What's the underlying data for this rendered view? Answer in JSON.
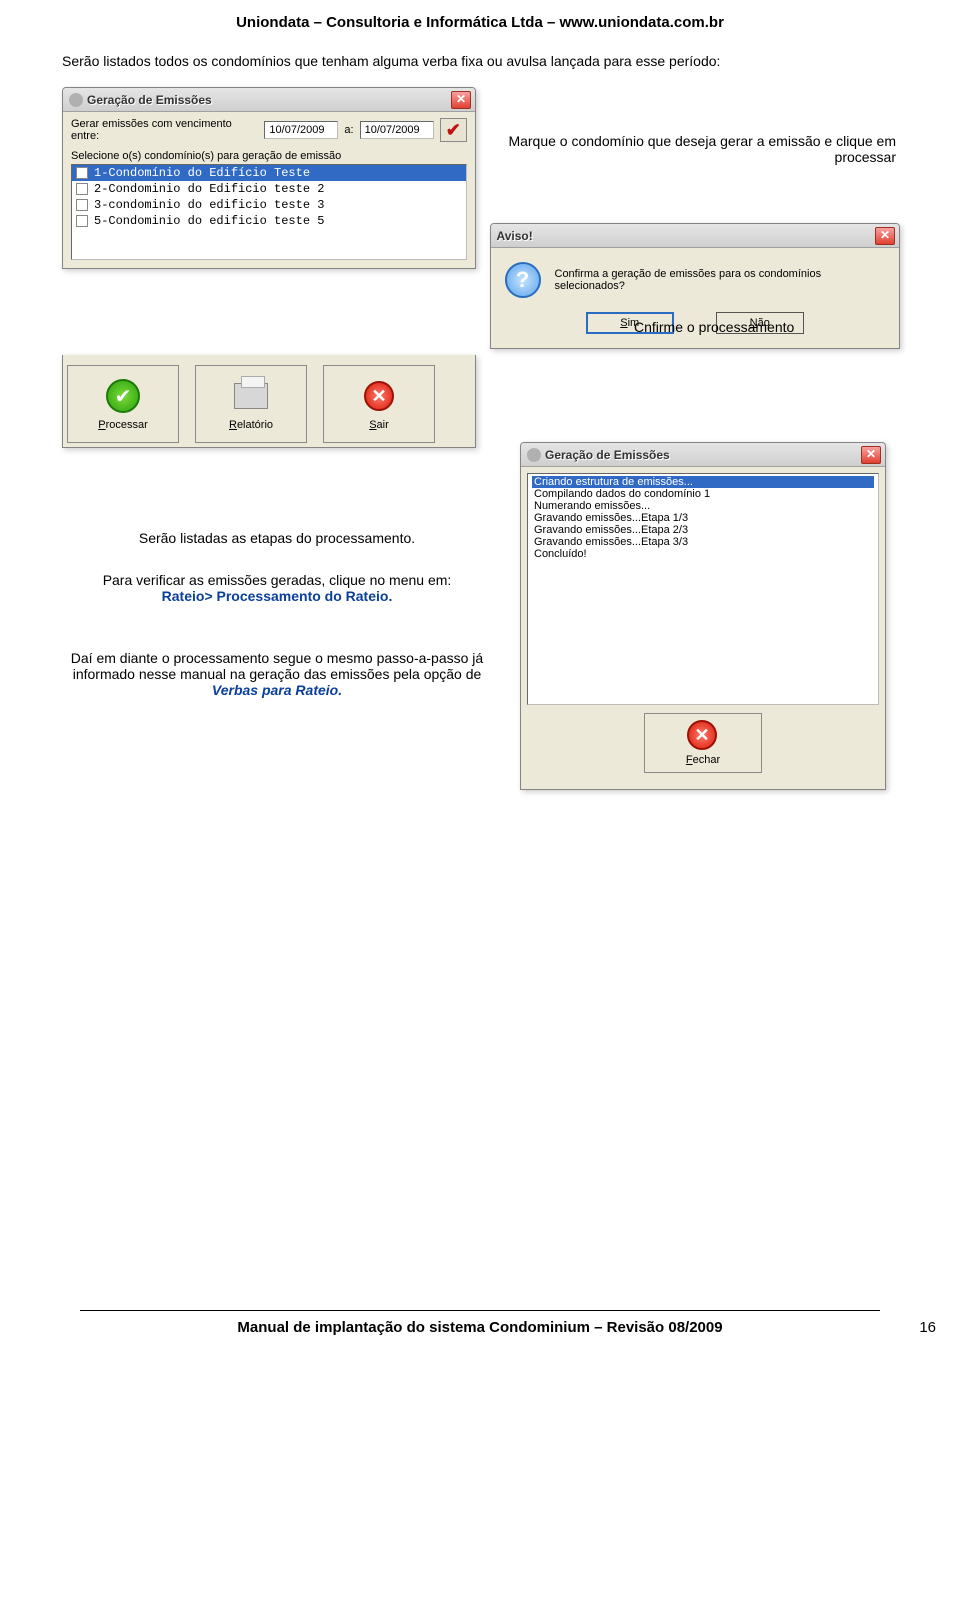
{
  "header": "Uniondata – Consultoria e Informática Ltda – www.uniondata.com.br",
  "intro": "Serão listados todos os condomínios que tenham alguma verba fixa ou avulsa lançada para esse período:",
  "marque_text": "Marque o condomínio que deseja gerar a emissão e clique em processar",
  "confirm_text": "Cnfirme o processamento",
  "etapas_text": "Serão listadas as etapas do processamento.",
  "verificar_text_1": "Para verificar as emissões geradas, clique no menu em:",
  "verificar_text_2": "Rateio> Processamento do Rateio.",
  "dai_text_1": "Daí em diante o processamento segue o mesmo passo-a-passo já informado nesse manual na geração das emissões pela opção de ",
  "dai_text_2": "Verbas para Rateio.",
  "win_emissoes": {
    "title": "Geração de Emissões",
    "label_gerar": "Gerar emissões com vencimento entre:",
    "date1": "10/07/2009",
    "label_a": "a:",
    "date2": "10/07/2009",
    "label_sel": "Selecione o(s) condomínio(s) para geração de emissão",
    "items": [
      "1-Condomínio do Edifício Teste",
      "2-Condominio do Edificio teste 2",
      "3-condominio do edificio teste 3",
      "5-Condominio do edificio teste 5"
    ],
    "btn_proc": "Processar",
    "btn_rel": "Relatório",
    "btn_sair": "Sair"
  },
  "aviso": {
    "title": "Aviso!",
    "msg": "Confirma a geração de emissões para os condomínios selecionados?",
    "sim": "Sim",
    "nao": "Não"
  },
  "prog": {
    "title": "Geração de Emissões",
    "lines": [
      "Criando estrutura de emissões...",
      "Compilando dados do condomínio 1",
      "Numerando emissões...",
      "Gravando emissões...Etapa 1/3",
      "Gravando emissões...Etapa 2/3",
      "Gravando emissões...Etapa 3/3",
      "Concluído!"
    ],
    "fechar": "Fechar"
  },
  "footer_text": "Manual de implantação do sistema Condominium – Revisão 08/2009",
  "page_num": "16"
}
